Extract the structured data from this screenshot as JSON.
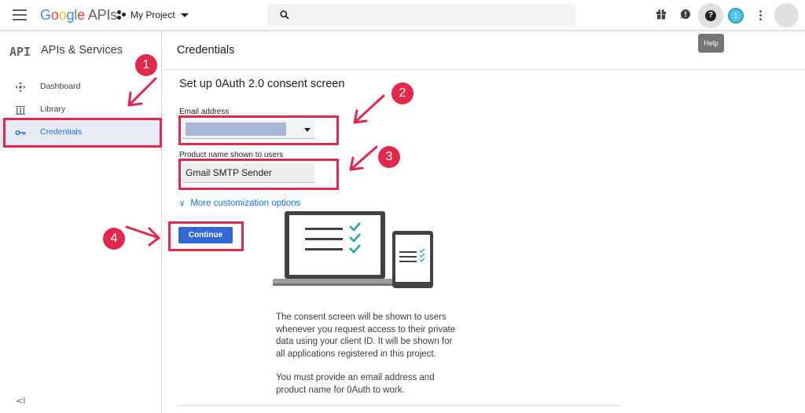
{
  "header": {
    "logo_google": [
      "G",
      "o",
      "o",
      "g",
      "l",
      "e"
    ],
    "logo_apis": "APIs",
    "project_name": "My Project",
    "help_tooltip": "Help",
    "notification_count": "1"
  },
  "sidebar": {
    "api_mark": "API",
    "title": "APIs & Services",
    "items": [
      {
        "label": "Dashboard",
        "icon": "dashboard-icon"
      },
      {
        "label": "Library",
        "icon": "library-icon"
      },
      {
        "label": "Credentials",
        "icon": "key-icon",
        "active": true
      }
    ],
    "collapse_label": "<I"
  },
  "main": {
    "page_title": "Credentials",
    "section_title": "Set up 0Auth 2.0 consent screen",
    "email_label": "Email address",
    "product_label": "Product name shown to users",
    "product_value": "Gmail SMTP Sender",
    "more_options": "More customization options",
    "continue_label": "Continue",
    "desc_paragraph_1": [
      "The consent screen will be shown to users",
      "whenever you request access to their private",
      "data using your client ID. It will be shown for",
      "all applications registered in this project."
    ],
    "desc_paragraph_2": [
      "You must provide an email address and",
      "product name for 0Auth to work."
    ]
  },
  "annotations": {
    "steps": [
      "1",
      "2",
      "3",
      "4"
    ],
    "color": "#e3294b"
  },
  "colors": {
    "accent": "#1a73e8",
    "button": "#3367d6",
    "check": "#26a69a"
  }
}
